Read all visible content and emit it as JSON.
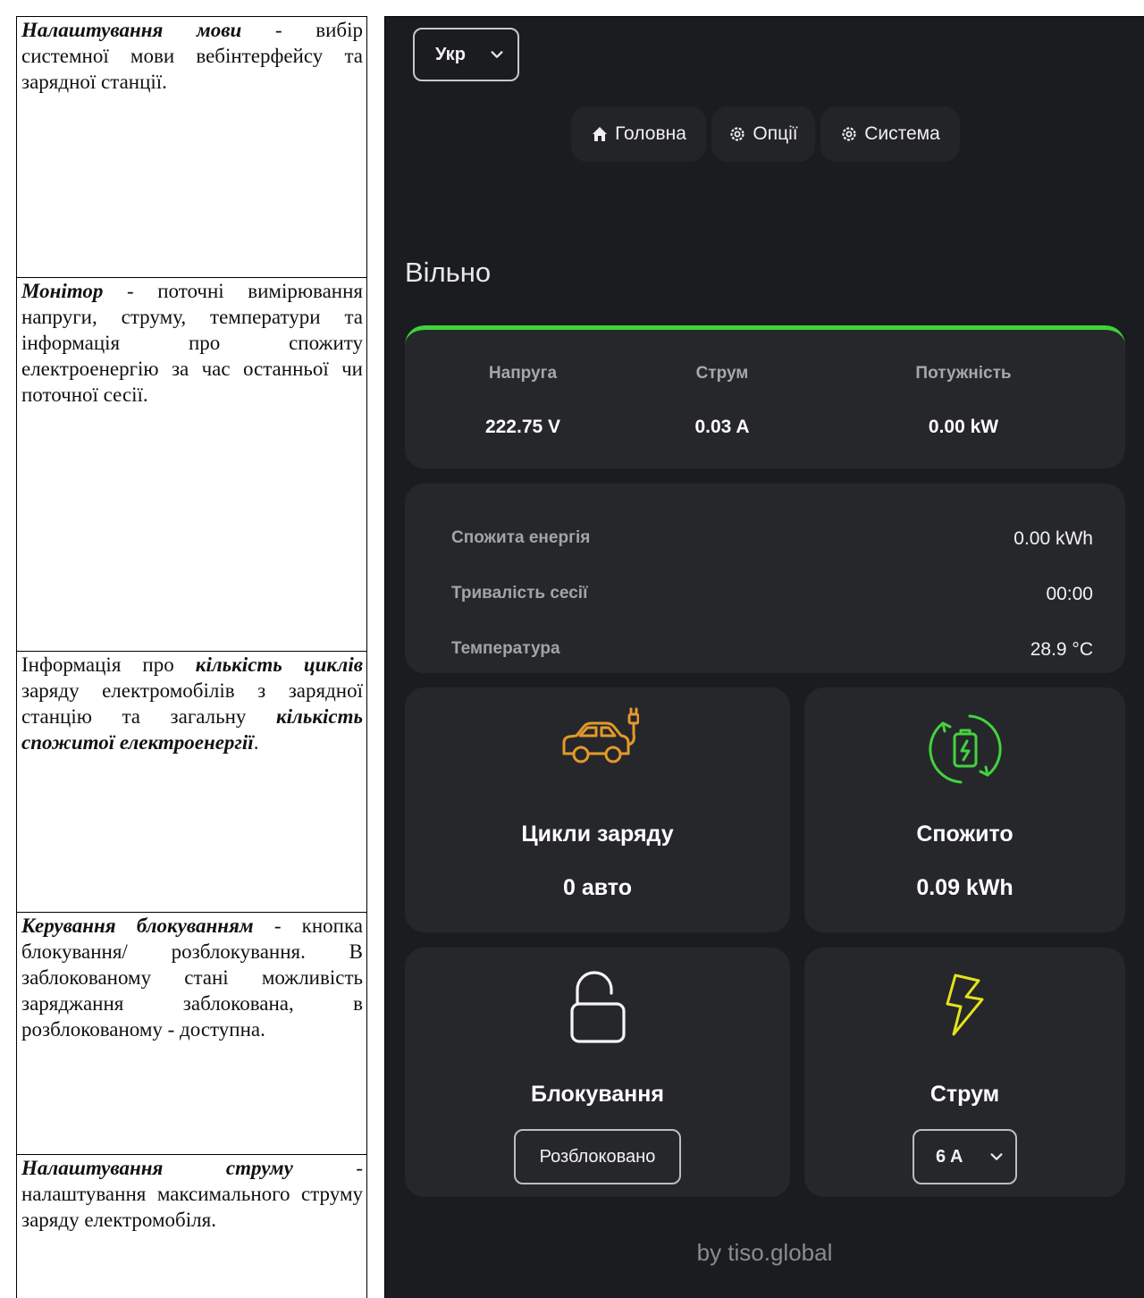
{
  "doc": {
    "language": {
      "term": "Налаштування мови",
      "text": " - вибір системної мови вебінтерфейсу та зарядної станції."
    },
    "monitor": {
      "term": "Монітор",
      "text": " - поточні вимірювання напруги, струму, температури та інформація про спожиту електроенергію за час останньої чи поточної сесії."
    },
    "cycles": {
      "pre": "Інформація про ",
      "term1": "кількість циклів",
      "mid": " заряду електромобілів з зарядної станцію та загальну ",
      "term2": "кількість спожитої електроенергії",
      "post": "."
    },
    "lock": {
      "term": "Керування блокуванням",
      "text": " - кнопка блокування/ розблокування. В заблокованому стані можливість заряджання заблокована, в розблокованому - доступна."
    },
    "current": {
      "term": "Налаштування струму",
      "text": " - налаштування максимального струму заряду електромобіля."
    }
  },
  "ui": {
    "language_select": "Укр",
    "nav": {
      "home": "Головна",
      "options": "Опції",
      "system": "Система"
    },
    "status": "Вільно",
    "accent_color": "#3fd23a",
    "monitor": {
      "voltage_label": "Напруга",
      "voltage_value": "222.75 V",
      "current_label": "Струм",
      "current_value": "0.03 A",
      "power_label": "Потужність",
      "power_value": "0.00 kW"
    },
    "info": {
      "energy_label": "Спожита енергія",
      "energy_value": "0.00 kWh",
      "duration_label": "Тривалість сесії",
      "duration_value": "00:00",
      "temperature_label": "Температура",
      "temperature_value": "28.9 °C"
    },
    "cycles_tile": {
      "icon": "car-charging-icon",
      "title": "Цикли заряду",
      "value": "0 авто"
    },
    "consumed_tile": {
      "icon": "battery-cycle-icon",
      "title": "Спожито",
      "value": "0.09 kWh"
    },
    "lock_tile": {
      "icon": "unlocked-padlock-icon",
      "title": "Блокування",
      "button": "Розблоковано"
    },
    "current_tile": {
      "icon": "lightning-icon",
      "title": "Струм",
      "select": "6 A"
    },
    "footer": "by tiso.global"
  }
}
